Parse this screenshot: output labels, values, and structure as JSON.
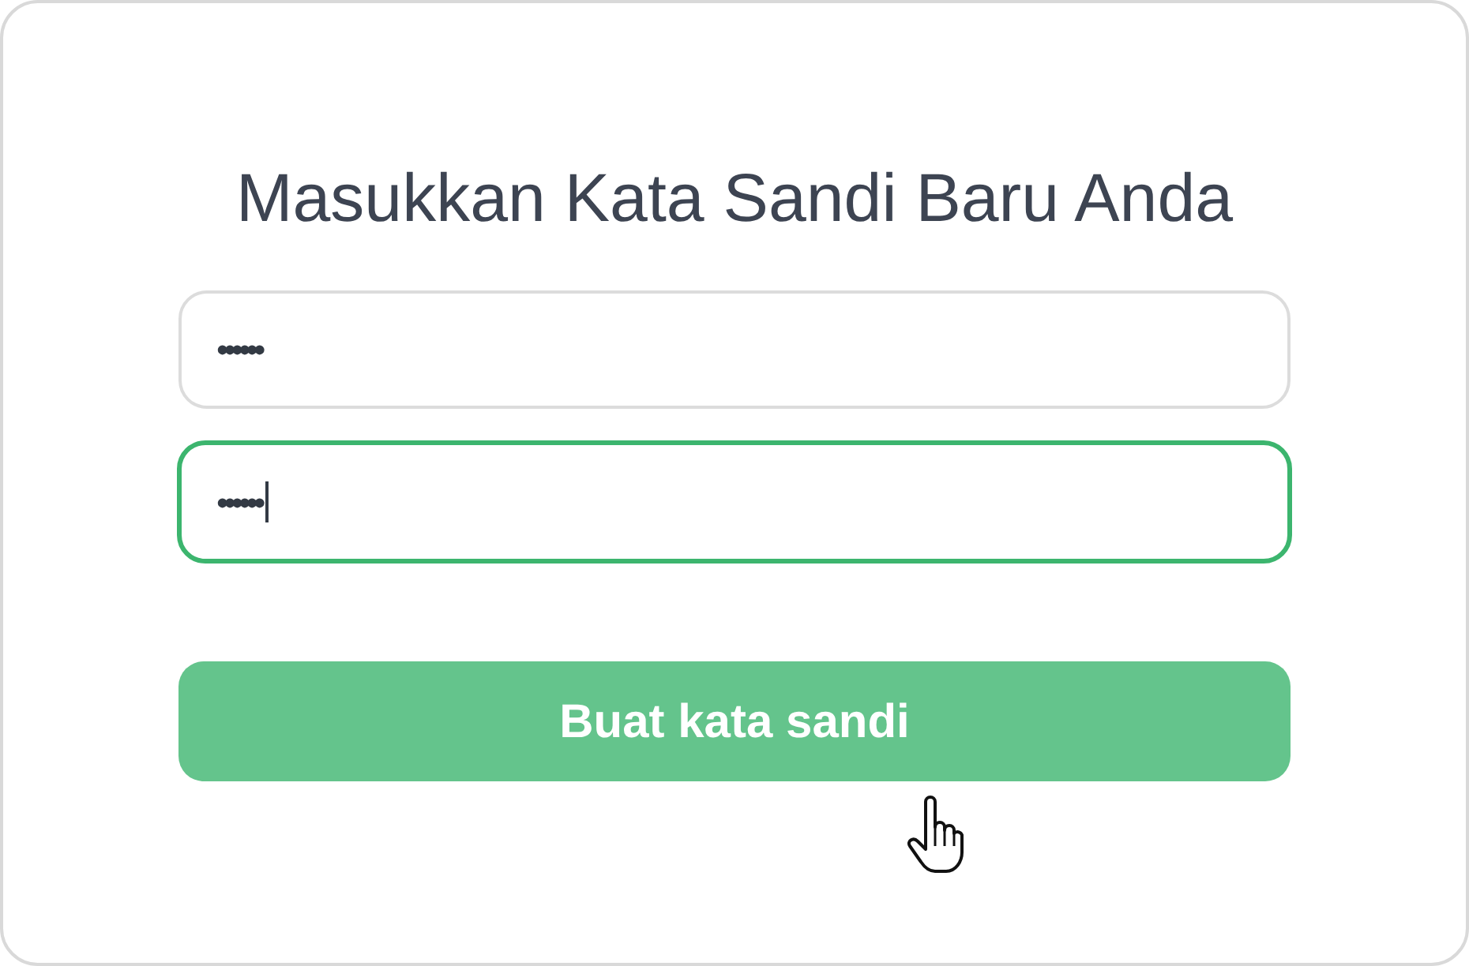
{
  "title": "Masukkan Kata Sandi Baru Anda",
  "fields": [
    {
      "value": "••••••",
      "focused": false
    },
    {
      "value": "••••••",
      "focused": true
    }
  ],
  "submit_button": {
    "label": "Buat kata sandi",
    "hovered": true
  }
}
